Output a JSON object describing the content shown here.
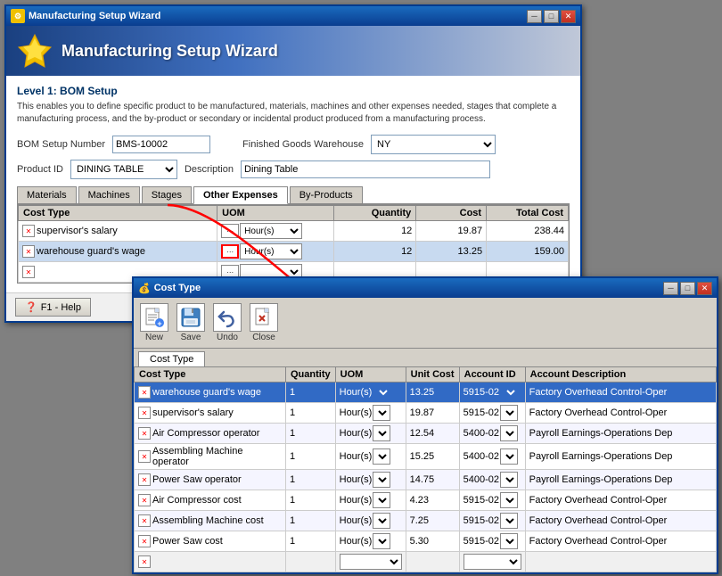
{
  "wizard": {
    "title": "Manufacturing Setup Wizard",
    "header_title": "Manufacturing Setup Wizard",
    "level_title": "Level 1: BOM Setup",
    "level_desc": "This enables you to define specific product to be manufactured, materials, machines and other expenses needed, stages that complete a manufacturing process, and the by-product or secondary or incidental product produced from a manufacturing process.",
    "bom_label": "BOM Setup Number",
    "bom_value": "BMS-10002",
    "fg_label": "Finished Goods Warehouse",
    "fg_value": "NY",
    "product_label": "Product ID",
    "product_value": "DINING TABLE",
    "desc_label": "Description",
    "desc_value": "Dining Table",
    "tabs": [
      "Materials",
      "Machines",
      "Stages",
      "Other Expenses",
      "By-Products"
    ],
    "active_tab": "Other Expenses",
    "table_headers": [
      "Cost Type",
      "UOM",
      "Quantity",
      "Cost",
      "Total Cost"
    ],
    "table_rows": [
      {
        "cost_type": "supervisor's salary",
        "uom": "Hour(s)",
        "quantity": "12",
        "cost": "19.87",
        "total": "238.44"
      },
      {
        "cost_type": "warehouse guard's wage",
        "uom": "Hour(s)",
        "quantity": "12",
        "cost": "13.25",
        "total": "159.00"
      }
    ],
    "help_btn": "F1 - Help"
  },
  "cost_type": {
    "title": "Cost Type",
    "tab_label": "Cost Type",
    "toolbar": {
      "new": "New",
      "save": "Save",
      "undo": "Undo",
      "close": "Close"
    },
    "table_headers": [
      "Cost Type",
      "Quantity",
      "UOM",
      "Unit Cost",
      "Account ID",
      "Account Description"
    ],
    "table_rows": [
      {
        "cost_type": "warehouse guard's wage",
        "qty": "1",
        "uom": "Hour(s)",
        "unit_cost": "13.25",
        "acct_id": "5915-02",
        "acct_desc": "Factory Overhead Control-Oper",
        "selected": true
      },
      {
        "cost_type": "supervisor's salary",
        "qty": "1",
        "uom": "Hour(s)",
        "unit_cost": "19.87",
        "acct_id": "5915-02",
        "acct_desc": "Factory Overhead Control-Oper",
        "selected": false
      },
      {
        "cost_type": "Air Compressor operator",
        "qty": "1",
        "uom": "Hour(s)",
        "unit_cost": "12.54",
        "acct_id": "5400-02",
        "acct_desc": "Payroll Earnings-Operations Dep",
        "selected": false
      },
      {
        "cost_type": "Assembling Machine operator",
        "qty": "1",
        "uom": "Hour(s)",
        "unit_cost": "15.25",
        "acct_id": "5400-02",
        "acct_desc": "Payroll Earnings-Operations Dep",
        "selected": false
      },
      {
        "cost_type": "Power Saw operator",
        "qty": "1",
        "uom": "Hour(s)",
        "unit_cost": "14.75",
        "acct_id": "5400-02",
        "acct_desc": "Payroll Earnings-Operations Dep",
        "selected": false
      },
      {
        "cost_type": "Air Compressor cost",
        "qty": "1",
        "uom": "Hour(s)",
        "unit_cost": "4.23",
        "acct_id": "5915-02",
        "acct_desc": "Factory Overhead Control-Oper",
        "selected": false
      },
      {
        "cost_type": "Assembling Machine cost",
        "qty": "1",
        "uom": "Hour(s)",
        "unit_cost": "7.25",
        "acct_id": "5915-02",
        "acct_desc": "Factory Overhead Control-Oper",
        "selected": false
      },
      {
        "cost_type": "Power Saw cost",
        "qty": "1",
        "uom": "Hour(s)",
        "unit_cost": "5.30",
        "acct_id": "5915-02",
        "acct_desc": "Factory Overhead Control-Oper",
        "selected": false
      }
    ]
  },
  "icons": {
    "star": "★",
    "x": "✕",
    "dots": "···",
    "check": "✓",
    "minimize": "─",
    "maximize": "□",
    "close": "✕",
    "new": "📄",
    "save": "💾",
    "undo": "↩",
    "close_doc": "❌",
    "help": "?"
  }
}
